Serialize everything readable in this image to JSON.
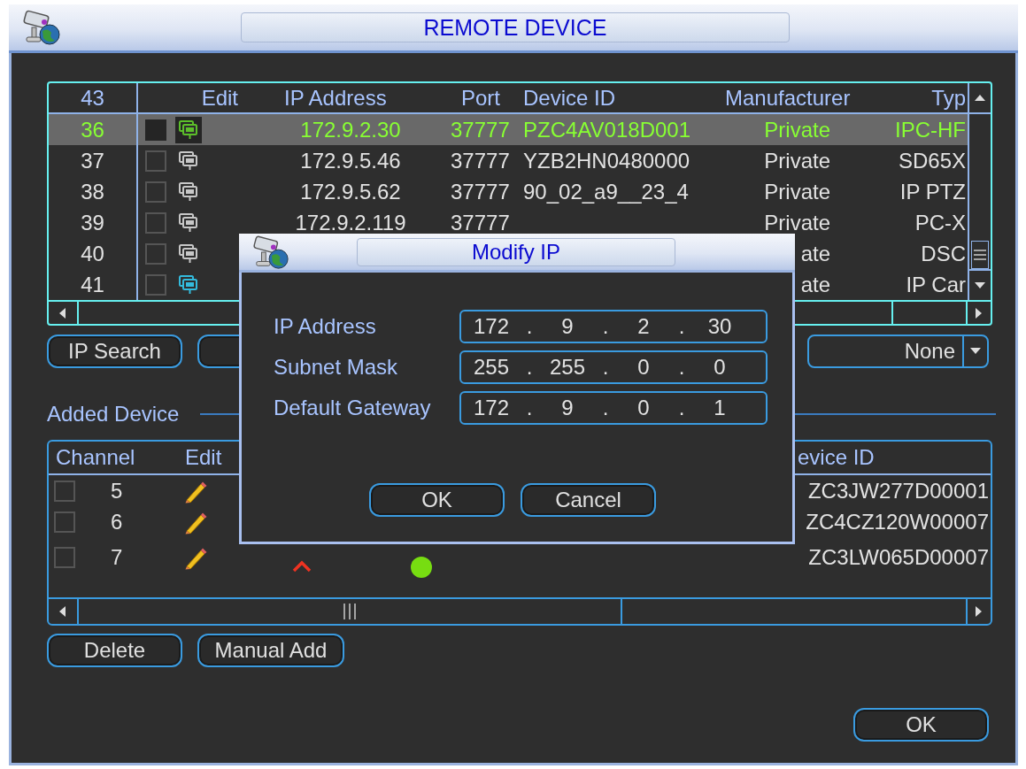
{
  "window": {
    "title": "REMOTE DEVICE"
  },
  "device_table": {
    "columns": [
      "43",
      "Edit",
      "IP Address",
      "Port",
      "Device ID",
      "Manufacturer",
      "Typ"
    ],
    "rows": [
      {
        "no": "36",
        "selected": true,
        "checked": false,
        "color": "#5cbf2a",
        "ip": "172.9.2.30",
        "port": "37777",
        "device_id": "PZC4AV018D001",
        "manufacturer": "Private",
        "type": "IPC-HF"
      },
      {
        "no": "37",
        "selected": false,
        "checked": false,
        "color": "#c8c8c8",
        "ip": "172.9.5.46",
        "port": "37777",
        "device_id": "YZB2HN0480000",
        "manufacturer": "Private",
        "type": "SD65X"
      },
      {
        "no": "38",
        "selected": false,
        "checked": false,
        "color": "#c8c8c8",
        "ip": "172.9.5.62",
        "port": "37777",
        "device_id": "90_02_a9__23_4",
        "manufacturer": "Private",
        "type": "IP PTZ"
      },
      {
        "no": "39",
        "selected": false,
        "checked": false,
        "color": "#c8c8c8",
        "ip": "172.9.2.119",
        "port": "37777",
        "manufacturer": "Private",
        "type": "PC-X"
      },
      {
        "no": "40",
        "selected": false,
        "checked": false,
        "color": "#c8c8c8",
        "manufacturer": "ate",
        "type": "DSC"
      },
      {
        "no": "41",
        "selected": false,
        "checked": false,
        "color": "#33bbdd",
        "manufacturer": "ate",
        "type": "IP Car"
      }
    ]
  },
  "search_button": "IP Search",
  "filter": {
    "value": "None"
  },
  "added": {
    "label": "Added Device",
    "columns": [
      "Channel",
      "Edit",
      "evice ID"
    ],
    "rows": [
      {
        "checked": false,
        "channel": "5",
        "device_id": "ZC3JW277D00001"
      },
      {
        "checked": false,
        "channel": "6",
        "device_id": "ZC4CZ120W00007"
      },
      {
        "checked": false,
        "channel": "7",
        "device_id": "ZC3LW065D00007",
        "status": {
          "connected": true
        }
      }
    ]
  },
  "added_buttons": [
    "Delete",
    "Manual Add"
  ],
  "ok_button": "OK",
  "dialog": {
    "title": "Modify IP",
    "separator": ".",
    "fields": [
      {
        "label": "IP Address",
        "octets": [
          "172",
          "9",
          "2",
          "30"
        ]
      },
      {
        "label": "Subnet Mask",
        "octets": [
          "255",
          "255",
          "0",
          "0"
        ]
      },
      {
        "label": "Default Gateway",
        "octets": [
          "172",
          "9",
          "0",
          "1"
        ]
      }
    ],
    "buttons": [
      "OK",
      "Cancel"
    ]
  }
}
